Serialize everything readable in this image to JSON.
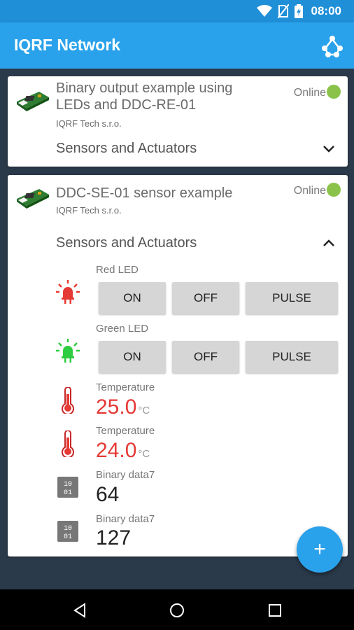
{
  "status_bar": {
    "time": "08:00"
  },
  "app_bar": {
    "title": "IQRF Network",
    "action_icon": "network-icon"
  },
  "devices": [
    {
      "title": "Binary output example using LEDs and DDC-RE-01",
      "vendor": "IQRF Tech s.r.o.",
      "status": "Online",
      "section_title": "Sensors and Actuators",
      "expanded": false
    },
    {
      "title": "DDC-SE-01 sensor example",
      "vendor": "IQRF Tech s.r.o.",
      "status": "Online",
      "section_title": "Sensors and Actuators",
      "expanded": true,
      "items": [
        {
          "type": "led",
          "label": "Red LED",
          "color": "#e53935",
          "buttons": [
            "ON",
            "OFF",
            "PULSE"
          ]
        },
        {
          "type": "led",
          "label": "Green LED",
          "color": "#2ecc40",
          "buttons": [
            "ON",
            "OFF",
            "PULSE"
          ]
        },
        {
          "type": "temperature",
          "label": "Temperature",
          "value": "25.0",
          "unit": "°C"
        },
        {
          "type": "temperature",
          "label": "Temperature",
          "value": "24.0",
          "unit": "°C"
        },
        {
          "type": "binary",
          "label": "Binary data7",
          "value": "64"
        },
        {
          "type": "binary",
          "label": "Binary data7",
          "value": "127"
        }
      ]
    }
  ],
  "fab": {
    "label": "+"
  },
  "colors": {
    "primary": "#2aa2eb",
    "status_bar": "#1f8fd8",
    "online": "#8bc34a",
    "background": "#2b3a4a",
    "value_red": "#e53935"
  }
}
